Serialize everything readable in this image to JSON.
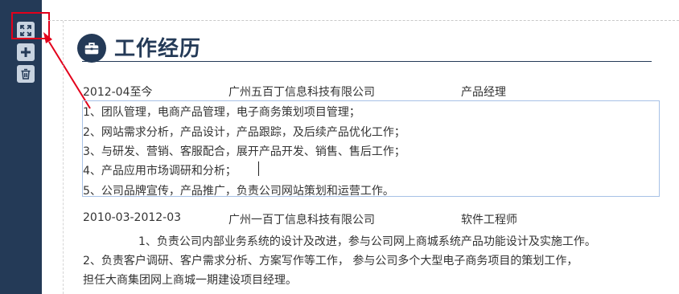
{
  "toolbar": {
    "buttons": [
      {
        "name": "expand",
        "icon": "expand-icon"
      },
      {
        "name": "add",
        "icon": "plus-icon"
      },
      {
        "name": "delete",
        "icon": "trash-icon"
      }
    ]
  },
  "section": {
    "icon": "briefcase-icon",
    "title": "工作经历"
  },
  "jobs": [
    {
      "period": "2012-04至今",
      "company": "广州五百丁信息科技有限公司",
      "position": "产品经理",
      "lines": [
        "1、团队管理，电商产品管理，电子商务策划项目管理；",
        "2、网站需求分析，产品设计，产品跟踪，及后续产品优化工作；",
        "3、与研发、营销、客服配合，展开产品开发、销售、售后工作；",
        "4、产品应用市场调研和分析；",
        "5、公司品牌宣传，产品推广，负责公司网站策划和运营工作。"
      ]
    },
    {
      "period": "2010-03-2012-03",
      "company": "广州一百丁信息科技有限公司",
      "position": "软件工程师",
      "lines": [
        "1、负责公司内部业务系统的设计及改进，参与公司网上商城系统产品功能设计及实施工作。",
        "2、负责客户调研、客户需求分析、方案写作等工作， 参与公司多个大型电子商务项目的策划工作，",
        "担任大商集团网上商城一期建设项目经理。"
      ]
    }
  ],
  "colors": {
    "sidebar": "#243a57",
    "accent": "#243a57",
    "highlight": "#e3001b",
    "editor_border": "#a7c1e6"
  }
}
